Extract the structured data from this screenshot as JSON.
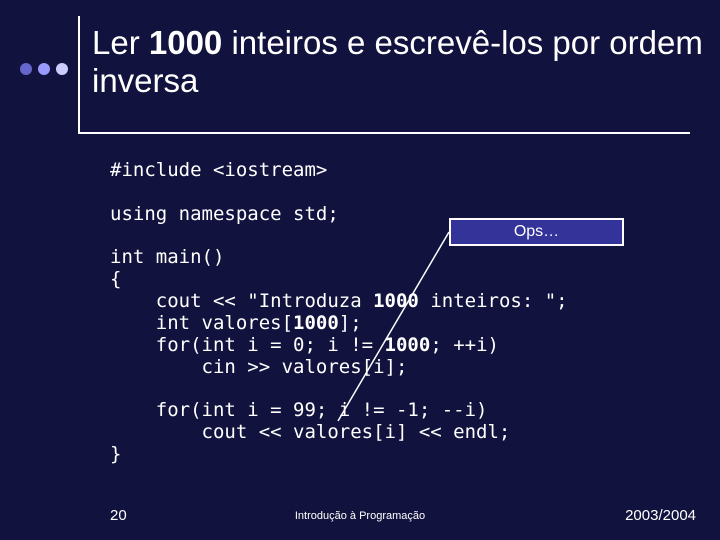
{
  "title_part1": "Ler ",
  "title_bold": "1000",
  "title_part2": " inteiros e escrevê-los por ordem inversa",
  "callout": "Ops…",
  "code": {
    "l1": "#include <iostream>",
    "l2": "",
    "l3": "using namespace std;",
    "l4": "",
    "l5": "int main()",
    "l6": "{",
    "l7a": "    cout << \"Introduza ",
    "l7b": "1000",
    "l7c": " inteiros: \";",
    "l8a": "    int valores[",
    "l8b": "1000",
    "l8c": "];",
    "l9a": "    for(int i = 0; i != ",
    "l9b": "1000",
    "l9c": "; ++i)",
    "l10": "        cin >> valores[i];",
    "l11": "",
    "l12": "    for(int i = 99; i != -1; --i)",
    "l13": "        cout << valores[i] << endl;",
    "l14": "}"
  },
  "footer": {
    "num": "20",
    "center": "Introdução à Programação",
    "right": "2003/2004"
  }
}
